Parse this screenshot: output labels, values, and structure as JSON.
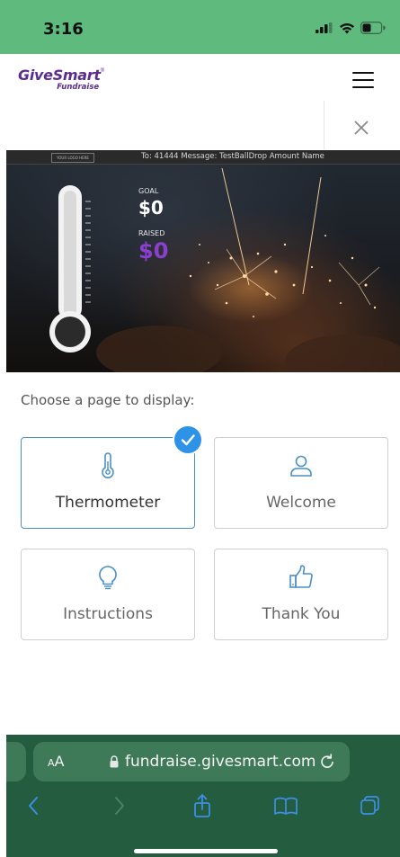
{
  "status_bar": {
    "time": "3:16"
  },
  "header": {
    "logo_main": "GiveSmart",
    "logo_sub": "Fundraise"
  },
  "preview": {
    "logo_placeholder": "YOUR LOGO HERE",
    "message": "To: 41444 Message: TestBallDrop Amount Name",
    "goal_label": "GOAL",
    "goal_value": "$0",
    "raised_label": "RAISED",
    "raised_value": "$0"
  },
  "choose": {
    "title": "Choose a page to display:",
    "tiles": [
      {
        "label": "Thermometer",
        "icon": "thermometer-icon",
        "selected": true
      },
      {
        "label": "Welcome",
        "icon": "person-icon",
        "selected": false
      },
      {
        "label": "Instructions",
        "icon": "lightbulb-icon",
        "selected": false
      },
      {
        "label": "Thank You",
        "icon": "thumbs-up-icon",
        "selected": false
      }
    ]
  },
  "browser": {
    "text_size_label": "AA",
    "url": "fundraise.givesmart.com"
  },
  "colors": {
    "status_bar": "#5fba7d",
    "brand_purple": "#5b2d8e",
    "raised_purple": "#8a3fd0",
    "selected_blue": "#2e93e6",
    "browser_green": "#245c3f"
  }
}
